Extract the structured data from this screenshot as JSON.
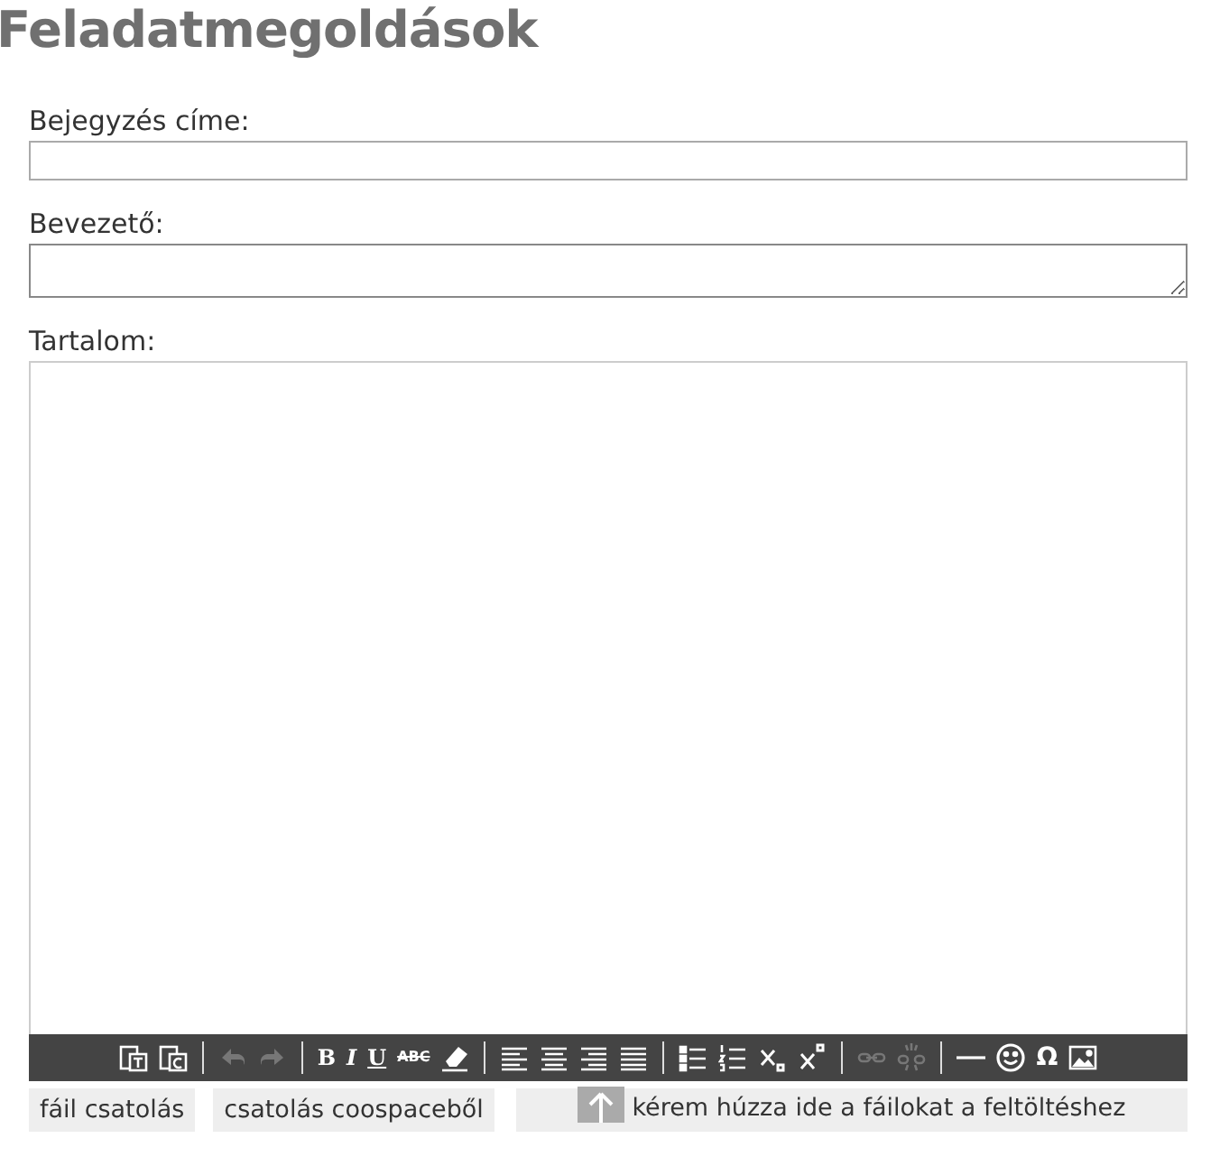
{
  "title": "Feladatmegoldások",
  "fields": [
    {
      "label": "Bejegyzés címe:",
      "kind": "input"
    },
    {
      "label": "Bevezető:",
      "kind": "textarea"
    }
  ],
  "editor": {
    "label": "Tartalom:",
    "toolbar": [
      [
        {
          "kind": "paste-text",
          "disabled": false
        },
        {
          "kind": "paste-word",
          "disabled": false
        }
      ],
      [
        {
          "kind": "undo",
          "disabled": true
        },
        {
          "kind": "redo",
          "disabled": true
        }
      ],
      [
        {
          "kind": "bold",
          "label": "B",
          "disabled": false
        },
        {
          "kind": "italic",
          "label": "I",
          "disabled": false
        },
        {
          "kind": "underline",
          "label": "U",
          "disabled": false
        },
        {
          "kind": "strike",
          "label": "ABC",
          "disabled": false
        },
        {
          "kind": "eraser",
          "disabled": false
        }
      ],
      [
        {
          "kind": "align-left",
          "disabled": false
        },
        {
          "kind": "align-center",
          "disabled": false
        },
        {
          "kind": "align-right",
          "disabled": false
        },
        {
          "kind": "justify",
          "disabled": false
        }
      ],
      [
        {
          "kind": "bullets",
          "disabled": false
        },
        {
          "kind": "numbers",
          "disabled": false
        },
        {
          "kind": "subscript",
          "disabled": false
        },
        {
          "kind": "superscript",
          "disabled": false
        }
      ],
      [
        {
          "kind": "link",
          "disabled": true
        },
        {
          "kind": "unlink",
          "disabled": true
        }
      ],
      [
        {
          "kind": "rule",
          "disabled": false
        },
        {
          "kind": "smiley",
          "disabled": false
        },
        {
          "kind": "omega",
          "label": "Ω",
          "disabled": false
        },
        {
          "kind": "image",
          "disabled": false
        }
      ]
    ]
  },
  "attach": [
    {
      "label": "fáil csatolás"
    },
    {
      "label": "csatolás coospaceből"
    }
  ],
  "dropzone": {
    "label": "kérem húzza ide a fáilokat a feltöltéshez"
  }
}
